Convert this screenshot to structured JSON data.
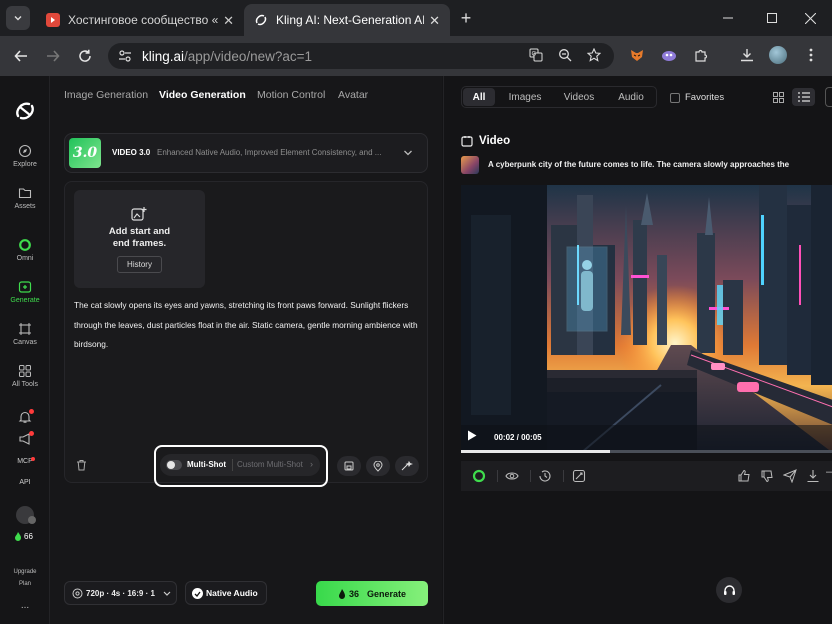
{
  "browser": {
    "tabs": [
      {
        "title": "Хостинговое сообщество «Tim",
        "active": false
      },
      {
        "title": "Kling AI: Next-Generation AI Cr",
        "active": true
      }
    ],
    "url_domain": "kling.ai",
    "url_path": "/app/video/new?ac=1"
  },
  "sidebar": {
    "items": [
      {
        "label": "Explore",
        "icon": "compass-icon"
      },
      {
        "label": "Assets",
        "icon": "folder-icon"
      },
      {
        "label": "Omni",
        "icon": "omni-ring-icon"
      },
      {
        "label": "Generate",
        "icon": "generate-icon",
        "active": true
      },
      {
        "label": "Canvas",
        "icon": "canvas-icon"
      },
      {
        "label": "All Tools",
        "icon": "grid-icon"
      },
      {
        "label": "MCP",
        "icon": "mcp-icon"
      },
      {
        "label": "API",
        "icon": "api-icon"
      }
    ],
    "credits": "66",
    "upgrade": "Upgrade",
    "plan": "Plan",
    "more": "..."
  },
  "left": {
    "tabs": [
      "Image Generation",
      "Video Generation",
      "Motion Control",
      "Avatar"
    ],
    "active_tab": "Video Generation",
    "model": {
      "badge": "3.0",
      "name": "VIDEO 3.0",
      "description": "Enhanced Native Audio, Improved Element Consistency, and ..."
    },
    "frames": {
      "line1": "Add start and",
      "line2": "end frames.",
      "history": "History"
    },
    "prompt": "The cat slowly opens its eyes and yawns, stretching its front paws forward. Sunlight flickers through the leaves, dust particles float in the air. Static camera, gentle morning ambience with birdsong.",
    "multishot": "Multi-Shot",
    "custom_multishot": "Custom Multi-Shot",
    "settings": "720p · 4s · 16:9 · 1",
    "native_audio": "Native Audio",
    "generate": {
      "cost": "36",
      "label": "Generate"
    }
  },
  "right": {
    "filters": [
      "All",
      "Images",
      "Videos",
      "Audio"
    ],
    "active_filter": "All",
    "favorites": "Favorites",
    "section_title": "Video",
    "video_prompt": "A cyberpunk city of the future comes to life. The camera slowly approaches the",
    "player": {
      "time": "00:02 / 00:05",
      "progress": 0.4
    }
  },
  "colors": {
    "accent_green": "#3fdc4d",
    "highlight_border": "#ffffff"
  }
}
